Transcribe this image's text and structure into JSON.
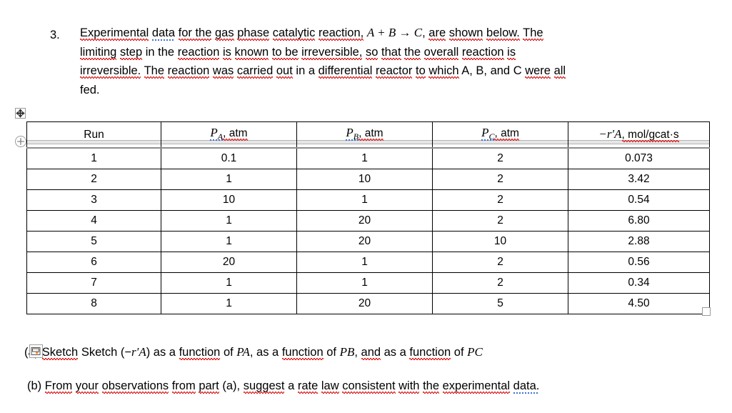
{
  "document": {
    "question_number": "3.",
    "question_text": {
      "line1_a": "Experimental data for the gas phase catalytic reaction, ",
      "reaction_equation": "A + B → C",
      "line1_b": ", are shown below. The",
      "line2": "limiting step in the reaction is known to be irreversible, so that the overall reaction is",
      "line3": "irreversible. The reaction was carried out in a differential reactor to which A, B, and C were all",
      "line4": "fed.",
      "words": {
        "experimental": "Experimental",
        "data": "data",
        "for_the": "for the",
        "gas": "gas",
        "phase": "phase",
        "catalytic": "catalytic",
        "reaction": "reaction,",
        "are": "are",
        "shown": "shown",
        "below": "below.",
        "the": "The",
        "limiting": "limiting",
        "step": "step",
        "in_the": "in the",
        "reaction2": "reaction",
        "is": "is",
        "known": "known",
        "to_be": "to be",
        "irreversible_c": "irreversible,",
        "so": "so",
        "that": "that",
        "the2": "the",
        "overall": "overall",
        "reaction3": "reaction",
        "is2": "is",
        "irreversible_p": "irreversible.",
        "the3": "The",
        "reaction4": "reaction",
        "was": "was",
        "carried": "carried",
        "out": "out",
        "in_a": "in a",
        "differential": "differential",
        "reactor": "reactor",
        "to": "to",
        "which": "which",
        "abc": "A, B, and C",
        "were": "were",
        "all": "all",
        "fed": "fed."
      }
    }
  },
  "table": {
    "name": "experimental-data-table",
    "headers": [
      {
        "label": "Run",
        "symbol": "",
        "subscript": "",
        "unit": ""
      },
      {
        "label": "P_A, atm",
        "symbol": "P",
        "subscript": "A",
        "unit": ", atm"
      },
      {
        "label": "P_B, atm",
        "symbol": "P",
        "subscript": "B",
        "unit": ", atm"
      },
      {
        "label": "P_C, atm",
        "symbol": "P",
        "subscript": "C",
        "unit": ", atm"
      },
      {
        "label": "−r′A, mol/gcat·s",
        "symbol": "−r′A",
        "subscript": "",
        "unit": ", mol/gcat·s"
      }
    ],
    "rows": [
      {
        "run": "1",
        "pa": "0.1",
        "pb": "1",
        "pc": "2",
        "rate": "0.073"
      },
      {
        "run": "2",
        "pa": "1",
        "pb": "10",
        "pc": "2",
        "rate": "3.42"
      },
      {
        "run": "3",
        "pa": "10",
        "pb": "1",
        "pc": "2",
        "rate": "0.54"
      },
      {
        "run": "4",
        "pa": "1",
        "pb": "20",
        "pc": "2",
        "rate": "6.80"
      },
      {
        "run": "5",
        "pa": "1",
        "pb": "20",
        "pc": "10",
        "rate": "2.88"
      },
      {
        "run": "6",
        "pa": "20",
        "pb": "1",
        "pc": "2",
        "rate": "0.56"
      },
      {
        "run": "7",
        "pa": "1",
        "pb": "1",
        "pc": "2",
        "rate": "0.34"
      },
      {
        "run": "8",
        "pa": "1",
        "pb": "20",
        "pc": "5",
        "rate": "4.50"
      }
    ]
  },
  "parts": {
    "a": {
      "label": "(a)",
      "text_1": "Sketch (−",
      "rate_sym": "r′A",
      "text_2": ") as a function of ",
      "pa_sym": "PA",
      "text_3": ", as a function of ",
      "pb_sym": "PB",
      "text_4": ", and as a function of ",
      "pc_sym": "PC",
      "words": {
        "sketch": "Sketch",
        "function1": "function",
        "function2": "function",
        "and": "and",
        "function3": "function"
      }
    },
    "b": {
      "label": "(b)",
      "text": "From your observations from part (a), suggest a rate law consistent with the experimental data.",
      "words": {
        "from1": "From",
        "your": "your",
        "observations": "observations",
        "from2": "from",
        "part": "part",
        "suggest": "suggest",
        "a": "a",
        "rate": "rate",
        "law": "law",
        "consistent": "consistent",
        "with": "with",
        "the": "the",
        "experimental": "experimental",
        "data": "data."
      }
    }
  },
  "controls": {
    "table_move_handle": "table-move-handle",
    "row_insert": "row-insert-control",
    "table_resize": "table-resize-handle",
    "autocorrect_options": "autocorrect-options-badge"
  },
  "colors": {
    "spelling_underline": "#e02020",
    "grammar_underline": "#3a6fd8",
    "table_border": "#000000",
    "header_rule": "#8d8d8d",
    "control_border": "#9a9a9a",
    "autocorrect_accent": "#e08020"
  }
}
